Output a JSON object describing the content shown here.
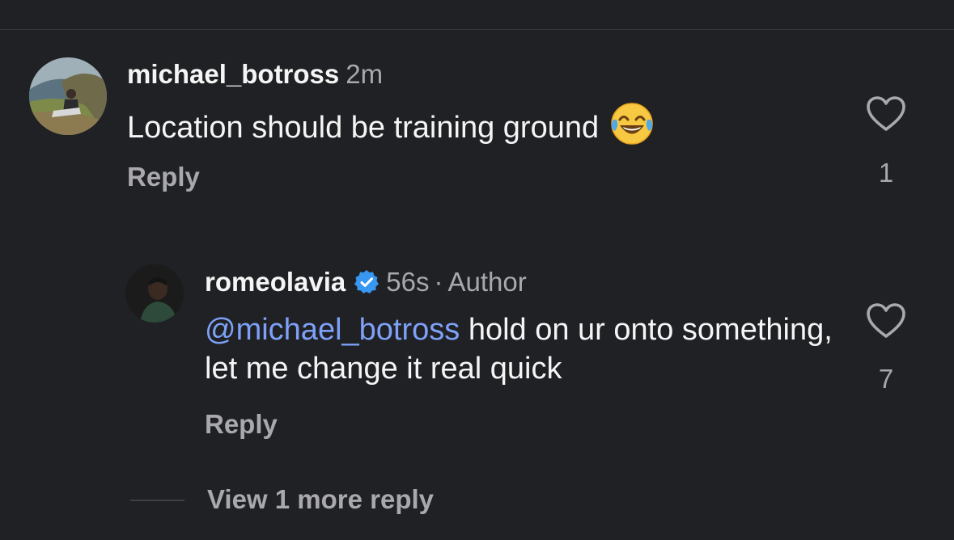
{
  "theme": {
    "background": "#202125",
    "text_primary": "#f5f5f5",
    "text_secondary": "#a8a8ad",
    "mention_color": "#7ea1f8",
    "verified_color": "#3897f0"
  },
  "comments": [
    {
      "username": "michael_botross",
      "time": "2m",
      "text": "Location should be training ground",
      "emoji": "face-with-tears-of-joy",
      "reply_label": "Reply",
      "like_count": "1",
      "like_icon": "heart-outline-icon"
    },
    {
      "username": "romeolavia",
      "verified": true,
      "time": "56s",
      "separator": "·",
      "author_label": "Author",
      "mention": "@michael_botross",
      "text": " hold on ur onto something, let me change it real quick",
      "reply_label": "Reply",
      "like_count": "7",
      "like_icon": "heart-outline-icon"
    }
  ],
  "view_more_label": "View 1 more reply"
}
